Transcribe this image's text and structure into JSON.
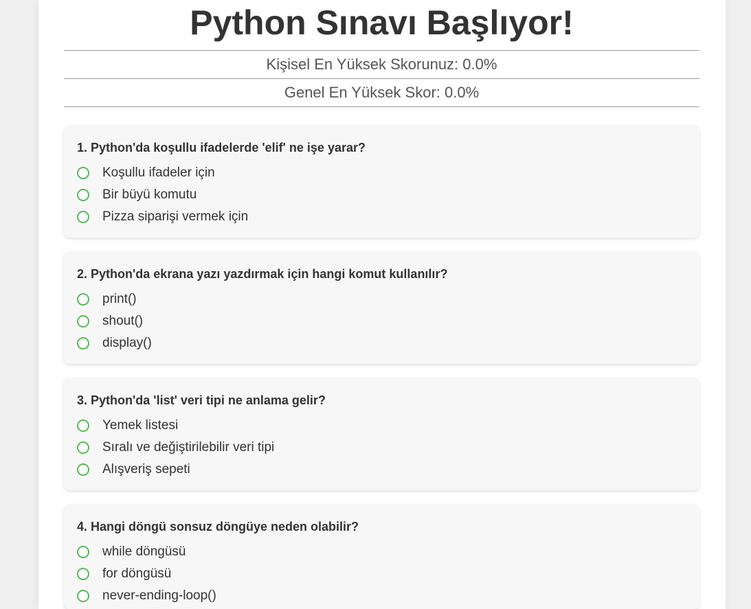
{
  "header": {
    "title": "Python Sınavı Başlıyor!",
    "personal_best": "Kişisel En Yüksek Skorunuz: 0.0%",
    "global_best": "Genel En Yüksek Skor: 0.0%"
  },
  "colors": {
    "radio_border": "#5cb85c",
    "card_bg": "#f7f7f7",
    "page_bg": "#f0f0f0"
  },
  "questions": [
    {
      "text": "1. Python'da koşullu ifadelerde 'elif' ne işe yarar?",
      "options": [
        "Koşullu ifadeler için",
        "Bir büyü komutu",
        "Pizza siparişi vermek için"
      ]
    },
    {
      "text": "2. Python'da ekrana yazı yazdırmak için hangi komut kullanılır?",
      "options": [
        "print()",
        "shout()",
        "display()"
      ]
    },
    {
      "text": "3. Python'da 'list' veri tipi ne anlama gelir?",
      "options": [
        "Yemek listesi",
        "Sıralı ve değiştirilebilir veri tipi",
        "Alışveriş sepeti"
      ]
    },
    {
      "text": "4. Hangi döngü sonsuz döngüye neden olabilir?",
      "options": [
        "while döngüsü",
        "for döngüsü",
        "never-ending-loop()"
      ]
    }
  ]
}
